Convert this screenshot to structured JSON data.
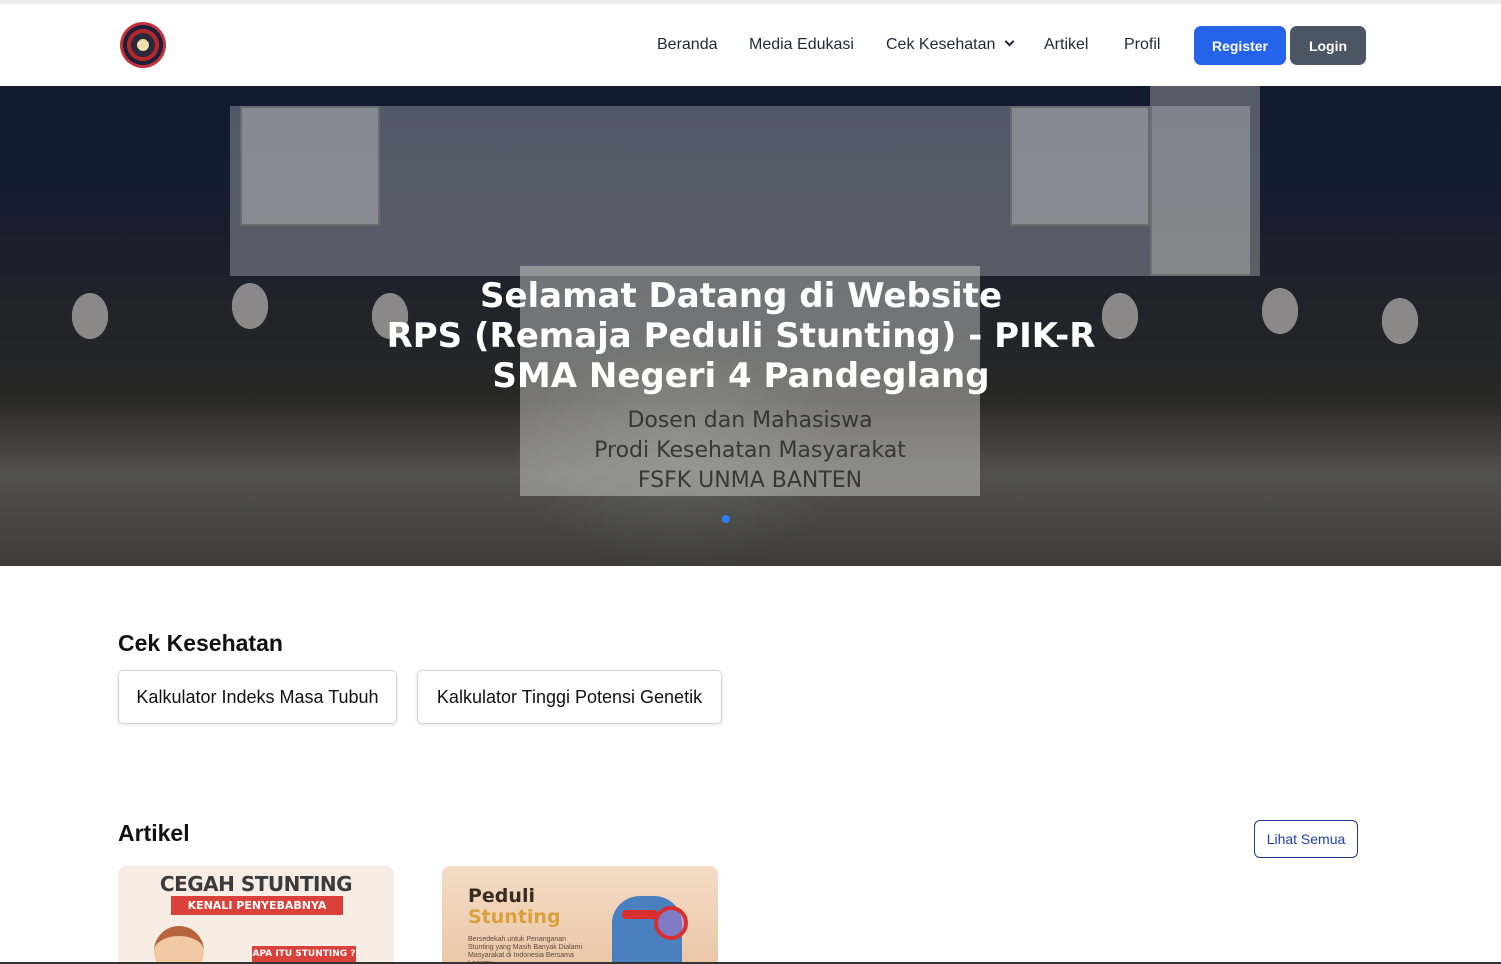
{
  "navbar": {
    "links": [
      {
        "label": "Beranda"
      },
      {
        "label": "Media Edukasi"
      },
      {
        "label": "Cek Kesehatan",
        "has_dropdown": true
      },
      {
        "label": "Artikel"
      },
      {
        "label": "Profil"
      }
    ],
    "register_label": "Register",
    "login_label": "Login",
    "register_color": "#2563eb",
    "login_color": "#4b5563"
  },
  "hero": {
    "title_lines": [
      "Selamat Datang di Website",
      "RPS (Remaja Peduli Stunting) - PIK-R",
      "SMA Negeri 4 Pandeglang"
    ],
    "banner_lines": [
      "Dosen dan Mahasiswa",
      "Prodi Kesehatan Masyarakat",
      "FSFK UNMA BANTEN"
    ],
    "active_slide_color": "#2f7df6"
  },
  "cek_kesehatan": {
    "title": "Cek Kesehatan",
    "buttons": [
      {
        "label": "Kalkulator Indeks Masa Tubuh"
      },
      {
        "label": "Kalkulator Tinggi Potensi Genetik"
      }
    ]
  },
  "artikel": {
    "title": "Artikel",
    "see_all_label": "Lihat Semua",
    "cards": [
      {
        "heading": "CEGAH STUNTING",
        "subheading": "KENALI PENYEBABNYA",
        "tag": "APA ITU STUNTING ?"
      },
      {
        "heading_line1": "Peduli",
        "heading_line2": "Stunting",
        "description": "Bersedekah untuk Penanganan Stunting yang Masih Banyak Dialami Masyarakat di Indonesia Bersama Lazismu"
      }
    ]
  }
}
